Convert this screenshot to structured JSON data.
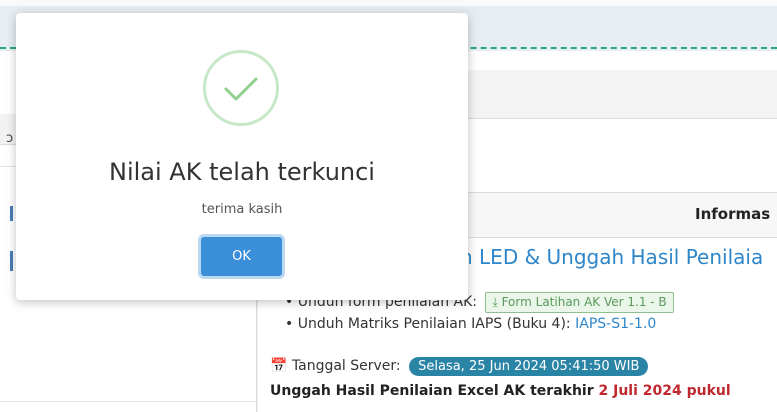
{
  "background": {
    "info_heading": "Informas",
    "main_link": "n LED & Unggah Hasil Penilaia",
    "bullet_ak_prefix": "• Unduh form penilaian AK:",
    "form_button": "⤓ Form Latihan AK Ver 1.1 - B",
    "bullet_matrix_prefix": "• Unduh Matriks Penilaian IAPS (Buku 4):",
    "matrix_link": "IAPS-S1-1.0",
    "server_label": "📅 Tanggal Server:",
    "server_date": "Selasa, 25 Jun 2024 05:41:50 WIB",
    "upload_text": "Unggah Hasil Penilaian Excel AK terakhir",
    "upload_deadline": "2 Juli 2024 pukul"
  },
  "modal": {
    "icon": "check-icon",
    "title": "Nilai AK telah terkunci",
    "text": "terima kasih",
    "ok_label": "OK"
  },
  "colors": {
    "accent": "#3b8ed8",
    "success": "#8fd08f",
    "badge": "#2a84a6",
    "deadline": "#c0282d"
  }
}
